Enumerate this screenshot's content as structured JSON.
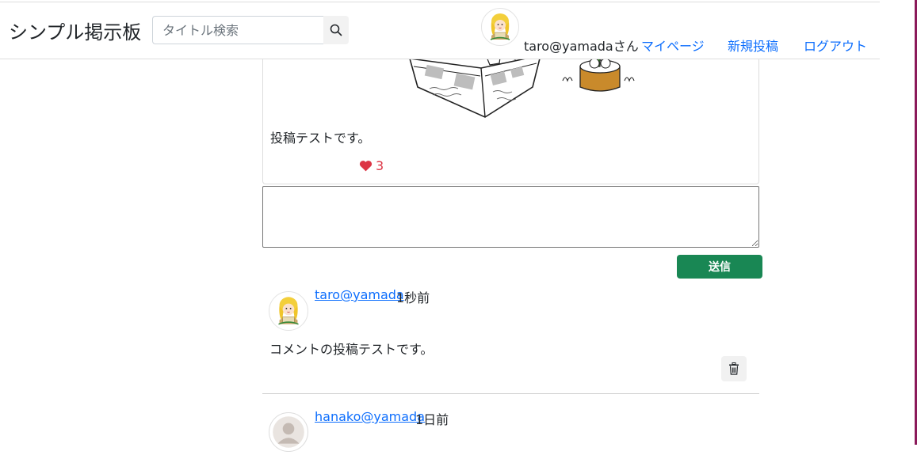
{
  "header": {
    "brand": "シンプル掲示板",
    "search_placeholder": "タイトル検索",
    "user_label": "taro@yamadaさん",
    "nav": {
      "mypage": "マイページ",
      "new_post": "新規投稿",
      "logout": "ログアウト"
    }
  },
  "post": {
    "body": "投稿テストです。",
    "like_count": "3"
  },
  "comment_form": {
    "value": "",
    "submit_label": "送信"
  },
  "comments": [
    {
      "user": "taro@yamada",
      "time": "1秒前",
      "body": "コメントの投稿テストです。"
    },
    {
      "user": "hanako@yamada",
      "time": "1日前"
    }
  ],
  "colors": {
    "link": "#0d6efd",
    "submit": "#198754",
    "like": "#dc3545"
  },
  "icons": {
    "search": "search-icon",
    "like": "heart-icon",
    "delete": "trash-icon",
    "default_avatar": "default-avatar-icon"
  }
}
